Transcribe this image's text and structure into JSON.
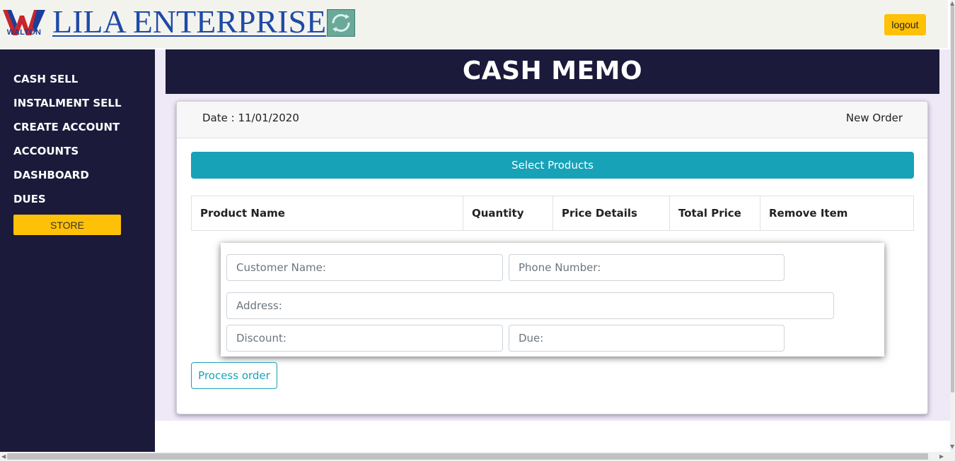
{
  "header": {
    "logo_text": "WALTON",
    "brand_title": "LILA ENTERPRISE",
    "logout_label": "logout",
    "refresh_icon": "refresh-icon"
  },
  "sidebar": {
    "items": [
      {
        "label": "CASH SELL"
      },
      {
        "label": "INSTALMENT SELL"
      },
      {
        "label": "CREATE ACCOUNT"
      },
      {
        "label": "ACCOUNTS"
      },
      {
        "label": "DASHBOARD"
      },
      {
        "label": "DUES"
      }
    ],
    "store_label": "STORE"
  },
  "main": {
    "banner_title": "CASH MEMO",
    "date_label": "Date : 11/01/2020",
    "new_order_label": "New Order",
    "select_products_label": "Select Products",
    "table_headers": [
      "Product Name",
      "Quantity",
      "Price Details",
      "Total Price",
      "Remove Item"
    ],
    "form": {
      "customer_name_placeholder": "Customer Name:",
      "phone_number_placeholder": "Phone Number:",
      "address_placeholder": "Address:",
      "discount_placeholder": "Discount:",
      "due_placeholder": "Due:"
    },
    "process_order_label": "Process order"
  },
  "colors": {
    "navy": "#1b1a3a",
    "teal": "#17a2b8",
    "yellow": "#ffc107",
    "brand_blue": "#1e4aa8"
  }
}
